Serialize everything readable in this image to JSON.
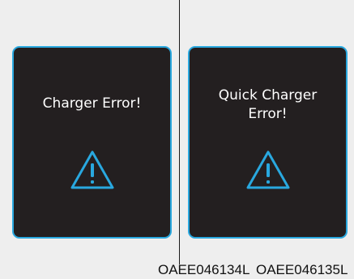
{
  "panels": [
    {
      "message": "Charger Error!",
      "icon": "warning-icon",
      "caption": "OAEE046134L"
    },
    {
      "message": "Quick Charger\nError!",
      "icon": "warning-icon",
      "caption": "OAEE046135L"
    }
  ],
  "colors": {
    "page_background": "#eeeeee",
    "panel_background": "#231f20",
    "accent": "#29a8df",
    "message_text": "#ffffff",
    "divider": "#1a1a1a"
  }
}
